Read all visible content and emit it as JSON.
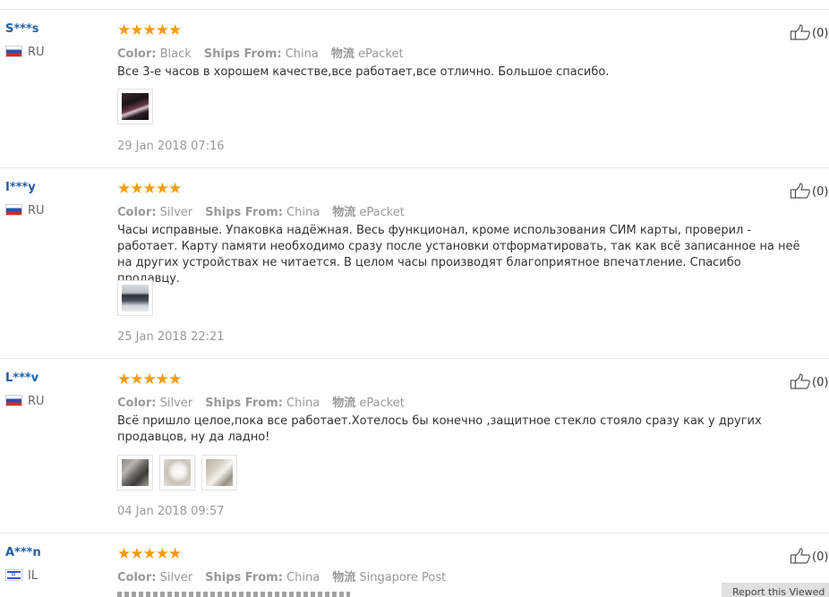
{
  "reviews": [
    {
      "user": "S***s",
      "country": "RU",
      "flag": "ru",
      "rating": "★★★★★",
      "color_label": "Color:",
      "color": "Black",
      "ships_label": "Ships From:",
      "ships": "China",
      "logistics_label": "物流",
      "logistics": "ePacket",
      "text": "Все 3-е часов в хорошем качестве,все работает,все отлично. Большое спасибо.",
      "photos": [
        "photo-1"
      ],
      "date": "29 Jan 2018 07:16",
      "likes": "(0)"
    },
    {
      "user": "I***y",
      "country": "RU",
      "flag": "ru",
      "rating": "★★★★★",
      "color_label": "Color:",
      "color": "Silver",
      "ships_label": "Ships From:",
      "ships": "China",
      "logistics_label": "物流",
      "logistics": "ePacket",
      "text": "Часы исправные. Упаковка надёжная. Весь функционал, кроме использования СИМ карты, проверил - работает. Карту памяти необходимо сразу после установки отформатировать, так как всё записанное на неё на других устройствах не читается. В целом часы производят благоприятное впечатление. Спасибо продавцу.",
      "photos": [
        "photo-1"
      ],
      "date": "25 Jan 2018 22:21",
      "likes": "(0)"
    },
    {
      "user": "L***v",
      "country": "RU",
      "flag": "ru",
      "rating": "★★★★★",
      "color_label": "Color:",
      "color": "Silver",
      "ships_label": "Ships From:",
      "ships": "China",
      "logistics_label": "物流",
      "logistics": "ePacket",
      "text": "Всё пришло целое,пока все работает.Хотелось бы конечно ,защитное стекло стояло сразу как у других продавцов, ну да ладно!",
      "photos": [
        "photo-1",
        "photo-2",
        "photo-3"
      ],
      "date": "04 Jan 2018 09:57",
      "likes": "(0)"
    },
    {
      "user": "A***n",
      "country": "IL",
      "flag": "il",
      "rating": "★★★★★",
      "color_label": "Color:",
      "color": "Silver",
      "ships_label": "Ships From:",
      "ships": "China",
      "logistics_label": "物流",
      "logistics": "Singapore Post",
      "text": "",
      "photos": [],
      "date": "",
      "likes": "(0)"
    }
  ],
  "tooltip": "Report this Viewed",
  "colors": {
    "accent_star": "#f49b12",
    "user_link": "#1f5fa8",
    "muted": "#999999"
  }
}
